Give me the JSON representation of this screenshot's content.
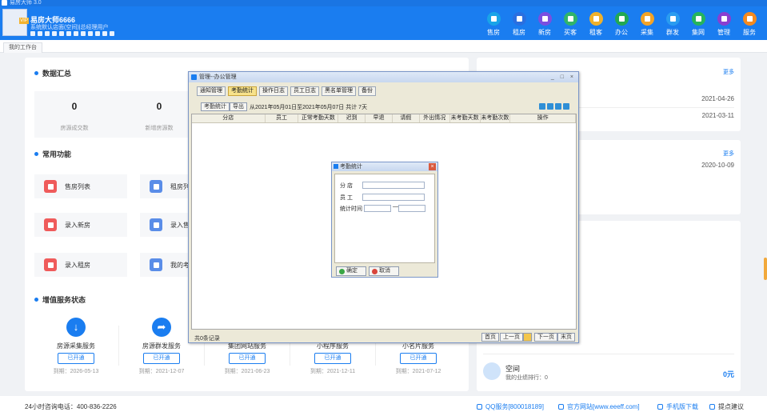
{
  "window": {
    "title": "易房大师 3.0"
  },
  "user": {
    "name": "易房大师6666",
    "sub": "系统默认店面(空间)|总经理用户",
    "badge": "VIP"
  },
  "nav": [
    {
      "label": "售房",
      "color": "#19a4e8",
      "icon": "house-icon"
    },
    {
      "label": "租房",
      "color": "#2a6fe0",
      "icon": "house-icon"
    },
    {
      "label": "新房",
      "color": "#7a4fe0",
      "icon": "building-icon"
    },
    {
      "label": "买客",
      "color": "#31b46a",
      "icon": "buyer-icon"
    },
    {
      "label": "租客",
      "color": "#efb12b",
      "icon": "renter-icon"
    },
    {
      "label": "办公",
      "color": "#22a852",
      "icon": "office-icon"
    },
    {
      "label": "采集",
      "color": "#f4a326",
      "icon": "cloud-icon"
    },
    {
      "label": "群发",
      "color": "#2a9cf0",
      "icon": "send-icon"
    },
    {
      "label": "集网",
      "color": "#26b45c",
      "icon": "web-icon"
    },
    {
      "label": "管理",
      "color": "#8a3fd0",
      "icon": "gear-icon"
    },
    {
      "label": "服务",
      "color": "#f58a1f",
      "icon": "service-icon"
    }
  ],
  "tab": "我的工作台",
  "summary": {
    "title": "数据汇总",
    "stats": [
      {
        "value": "0",
        "label": "房源成交数"
      },
      {
        "value": "0",
        "label": "新增房源数"
      }
    ]
  },
  "functions": {
    "title": "常用功能",
    "items": [
      {
        "label": "售房列表",
        "color": "#ef5b5b"
      },
      {
        "label": "租房列",
        "color": "#5a8de8"
      },
      {
        "label": "录入新房",
        "color": "#ef5b5b"
      },
      {
        "label": "录入售",
        "color": "#5a8de8"
      },
      {
        "label": "录入租房",
        "color": "#ef5b5b"
      },
      {
        "label": "我的考",
        "color": "#5a8de8"
      }
    ]
  },
  "services": {
    "title": "增值服务状态",
    "items": [
      {
        "name": "房源采集服务",
        "btn": "已开通",
        "date": "到期：2026-05-13"
      },
      {
        "name": "房源群发服务",
        "btn": "已开通",
        "date": "到期：2021-12-07"
      },
      {
        "name": "集团网站服务",
        "btn": "已开通",
        "date": "到期：2021-06-23"
      },
      {
        "name": "小程序服务",
        "btn": "已开通",
        "date": "到期：2021-12-11"
      },
      {
        "name": "小名片服务",
        "btn": "已开通",
        "date": "到期：2021-07-12"
      }
    ]
  },
  "news": {
    "title": "最新公告",
    "more": "更多",
    "dates": [
      "2021-04-26",
      "2021-03-11"
    ]
  },
  "news2": {
    "more": "更多",
    "date": "2020-10-09"
  },
  "rank": {
    "name": "空间",
    "sub": "我的业绩排行：0",
    "value": "0元"
  },
  "footer": {
    "phone": "24小时咨询电话：400-836-2226",
    "qq": "QQ服务[800018189]",
    "site": "官方网站[www.eeeff.com]",
    "mobile": "手机版下载",
    "feedback": "提点建议"
  },
  "office_window": {
    "title": "管理--办公管理",
    "tabs": [
      "通知管理",
      "考勤统计",
      "操作日志",
      "员工日志",
      "黑名单管理",
      "备份"
    ],
    "active_tab": "考勤统计",
    "toolbar": {
      "stat_btn": "考勤统计",
      "export_btn": "导出",
      "range": "从2021年05月01日至2021年05月07日 共计 7天"
    },
    "columns": [
      "分店",
      "员工",
      "正常考勤天数",
      "迟到",
      "早退",
      "请假",
      "外出情况",
      "未考勤天数",
      "未考勤次数",
      "操作"
    ],
    "record_count": "共0条记录",
    "pager": {
      "first": "首页",
      "prev": "上一页",
      "next": "下一页",
      "last": "末页"
    }
  },
  "stat_dialog": {
    "title": "考勤统计",
    "branch_label": "分   店",
    "staff_label": "员   工",
    "time_label": "统计时间",
    "ok": "确定",
    "cancel": "取消"
  }
}
